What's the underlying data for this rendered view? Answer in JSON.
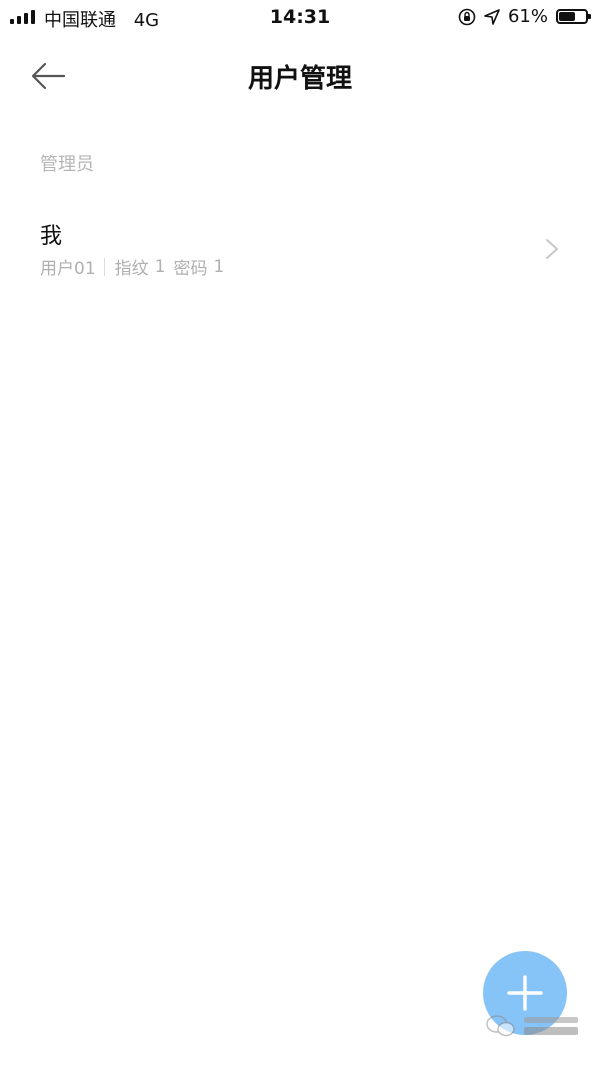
{
  "status_bar": {
    "carrier": "中国联通",
    "network": "4G",
    "time": "14:31",
    "battery_percent": "61%",
    "battery_level": 0.61
  },
  "nav": {
    "title": "用户管理",
    "back_icon": "arrow-left-icon"
  },
  "section": {
    "header": "管理员"
  },
  "users": [
    {
      "name": "我",
      "id": "用户01",
      "fingerprint_label": "指纹",
      "fingerprint_count": "1",
      "password_label": "密码",
      "password_count": "1"
    }
  ],
  "fab": {
    "icon": "plus-icon",
    "color": "#86c3f7"
  }
}
